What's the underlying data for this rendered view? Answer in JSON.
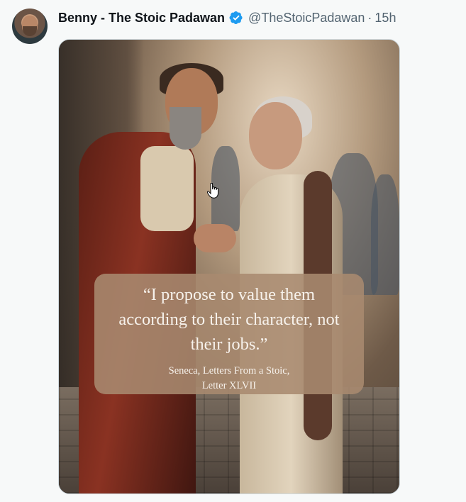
{
  "tweet": {
    "author_name": "Benny - The Stoic Padawan",
    "handle": "@TheStoicPadawan",
    "separator": "·",
    "time": "15h",
    "verified_color": "#1d9bf0"
  },
  "image": {
    "quote": "“I propose to value them according to their character, not their jobs.”",
    "attribution_line1": "Seneca, Letters From a Stoic,",
    "attribution_line2": "Letter XLVII"
  },
  "icons": {
    "verified": "verified-badge-icon",
    "cursor": "hand-pointer-cursor-icon"
  }
}
